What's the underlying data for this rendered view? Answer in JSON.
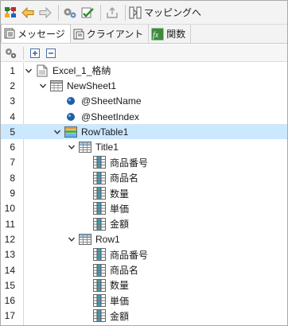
{
  "toolbar": {
    "mapping_label": "マッピングへ"
  },
  "tabs": [
    {
      "label": "メッセージ",
      "icon": "message-icon",
      "active": true
    },
    {
      "label": "クライアント",
      "icon": "client-icon",
      "active": false
    },
    {
      "label": "関数",
      "icon": "function-icon",
      "active": false
    }
  ],
  "colors": {
    "selected_row": "#cce8ff",
    "bullet": "#1f5fa8",
    "accent_orange": "#e8a33b",
    "accent_green": "#3c8b3c"
  },
  "tree": [
    {
      "line": "1",
      "depth": 0,
      "expanded": true,
      "icon": "document-icon",
      "label": "Excel_1_格納"
    },
    {
      "line": "2",
      "depth": 1,
      "expanded": true,
      "icon": "sheet-icon",
      "label": "NewSheet1"
    },
    {
      "line": "3",
      "depth": 2,
      "expanded": null,
      "icon": "attribute-icon",
      "label": "@SheetName"
    },
    {
      "line": "4",
      "depth": 2,
      "expanded": null,
      "icon": "attribute-icon",
      "label": "@SheetIndex"
    },
    {
      "line": "5",
      "depth": 2,
      "expanded": true,
      "icon": "rowtable-icon",
      "label": "RowTable1",
      "selected": true
    },
    {
      "line": "6",
      "depth": 3,
      "expanded": true,
      "icon": "table-icon",
      "label": "Title1"
    },
    {
      "line": "7",
      "depth": 4,
      "expanded": null,
      "icon": "column-icon",
      "label": "商品番号"
    },
    {
      "line": "8",
      "depth": 4,
      "expanded": null,
      "icon": "column-icon",
      "label": "商品名"
    },
    {
      "line": "9",
      "depth": 4,
      "expanded": null,
      "icon": "column-icon",
      "label": "数量"
    },
    {
      "line": "10",
      "depth": 4,
      "expanded": null,
      "icon": "column-icon",
      "label": "単価"
    },
    {
      "line": "11",
      "depth": 4,
      "expanded": null,
      "icon": "column-icon",
      "label": "金額"
    },
    {
      "line": "12",
      "depth": 3,
      "expanded": true,
      "icon": "table-icon",
      "label": "Row1"
    },
    {
      "line": "13",
      "depth": 4,
      "expanded": null,
      "icon": "column-icon",
      "label": "商品番号"
    },
    {
      "line": "14",
      "depth": 4,
      "expanded": null,
      "icon": "column-icon",
      "label": "商品名"
    },
    {
      "line": "15",
      "depth": 4,
      "expanded": null,
      "icon": "column-icon",
      "label": "数量"
    },
    {
      "line": "16",
      "depth": 4,
      "expanded": null,
      "icon": "column-icon",
      "label": "単価"
    },
    {
      "line": "17",
      "depth": 4,
      "expanded": null,
      "icon": "column-icon",
      "label": "金額"
    }
  ]
}
